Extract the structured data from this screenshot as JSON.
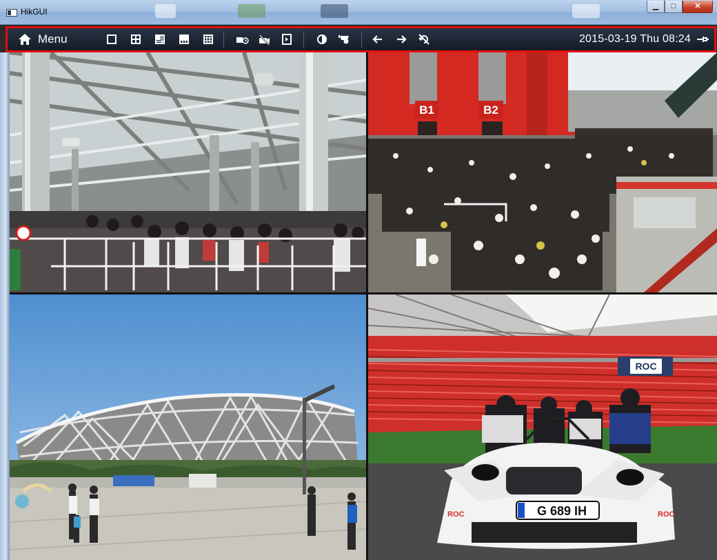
{
  "window": {
    "title": "HikGUI",
    "minimize_glyph": "▁",
    "maximize_glyph": "□",
    "close_glyph": "✕"
  },
  "toolbar": {
    "menu_label": "Menu",
    "datetime": "2015-03-19 Thu 08:24",
    "icons": {
      "home": "home-icon",
      "layout_1": "single-view-icon",
      "layout_4": "quad-view-icon",
      "layout_6": "six-view-icon",
      "layout_8": "eight-view-icon",
      "layout_9": "nine-view-icon",
      "playback": "playback-icon",
      "camera_off": "camera-off-icon",
      "output": "output-switch-icon",
      "image_settings": "image-settings-icon",
      "ptz": "ptz-icon",
      "prev": "arrow-left-icon",
      "next": "arrow-right-icon",
      "autoswitch_off": "auto-switch-off-icon",
      "pin": "pin-icon"
    }
  },
  "cameras": [
    {
      "name": "camera-1",
      "scene": "station-hall"
    },
    {
      "name": "camera-2",
      "scene": "crowd-plaza",
      "signs": [
        "B1",
        "B2"
      ]
    },
    {
      "name": "camera-3",
      "scene": "stadium-exterior"
    },
    {
      "name": "camera-4",
      "scene": "stadium-car",
      "signs": [
        "ROC",
        "G 689 IH",
        "ROC",
        "ROC"
      ]
    }
  ],
  "colors": {
    "toolbar_border": "#e01010",
    "toolbar_bg": "#1c2432",
    "sign_red": "#d42a22",
    "sky_blue": "#6aa4dc"
  }
}
